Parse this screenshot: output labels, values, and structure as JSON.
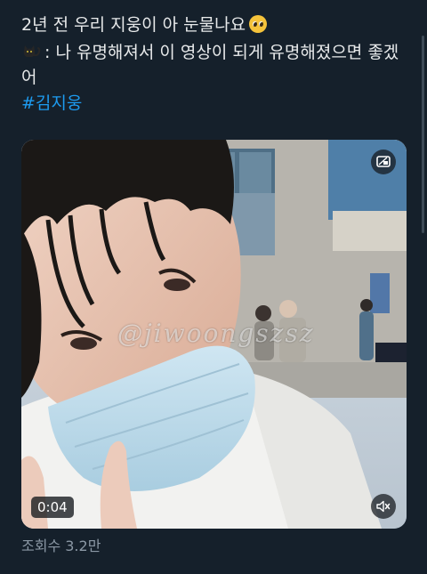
{
  "tweet": {
    "line1": "2년 전 우리 지웅이 아 눈물나요",
    "line1_emoji": "pleading-face",
    "line2": ": 나 유명해져서 이 영상이 되게 유명해졌으면 좋겠",
    "line2_emoji": "black-cat",
    "line3": "어",
    "hashtag": "#김지웅"
  },
  "media": {
    "watermark": "@jiwoongszsz",
    "duration": "0:04",
    "pip_icon": "picture-in-picture-icon",
    "mute_icon": "muted-speaker-icon"
  },
  "views": "조회수 3.2만",
  "colors": {
    "background": "#15202b",
    "text": "#e7e9ea",
    "hashtag": "#1d9bf0",
    "muted_text": "#8b98a5"
  }
}
